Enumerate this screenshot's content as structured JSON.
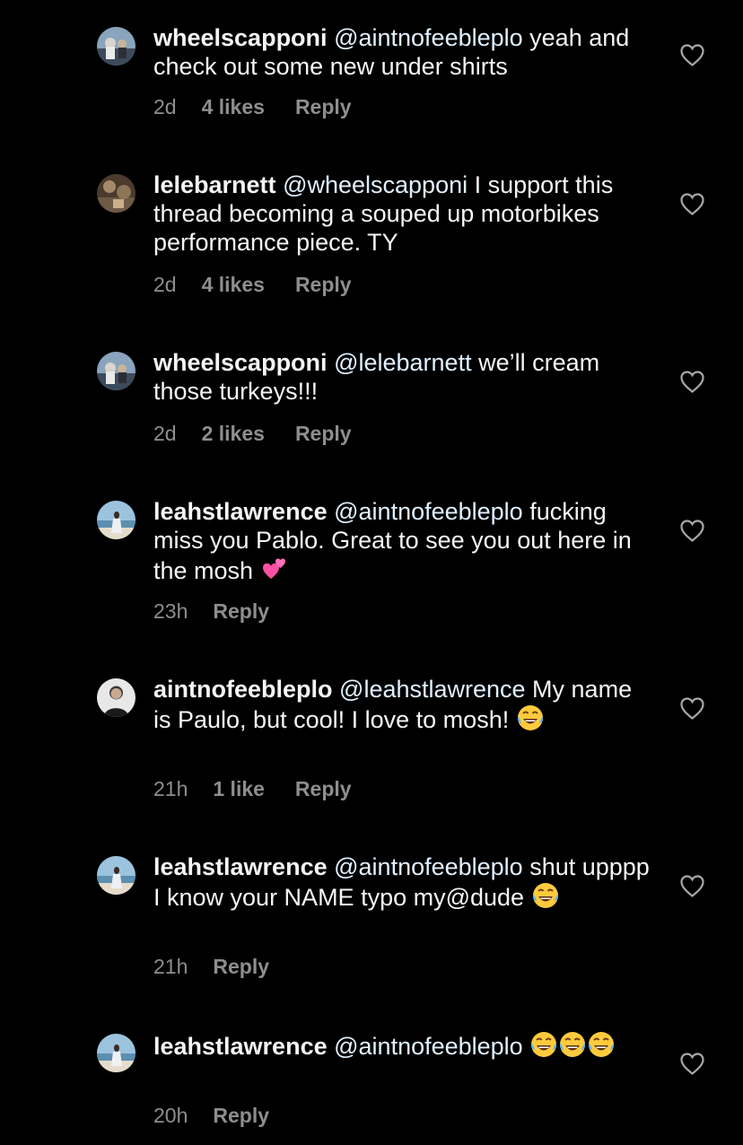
{
  "colors": {
    "background": "#000000",
    "text": "#f5f5f5",
    "mention": "#e0f1ff",
    "meta": "#8e8e8e"
  },
  "comments": [
    {
      "username": "wheelscapponi",
      "avatar": "wheelscapponi-avatar",
      "mention": "@aintnofeebleplo",
      "text": " yeah and check out some new under shirts",
      "emojis": [],
      "time": "2d",
      "likes": "4 likes",
      "reply": "Reply"
    },
    {
      "username": "lelebarnett",
      "avatar": "lelebarnett-avatar",
      "mention": "@wheelscapponi",
      "text": " I support this thread becoming a souped up motorbikes performance piece. TY",
      "emojis": [],
      "time": "2d",
      "likes": "4 likes",
      "reply": "Reply"
    },
    {
      "username": "wheelscapponi",
      "avatar": "wheelscapponi-avatar",
      "mention": "@lelebarnett",
      "text": " we’ll cream those turkeys!!!",
      "emojis": [],
      "time": "2d",
      "likes": "2 likes",
      "reply": "Reply"
    },
    {
      "username": "leahstlawrence",
      "avatar": "leahstlawrence-avatar",
      "mention": "@aintnofeebleplo",
      "text": " fucking miss you Pablo. Great to see you out here in the mosh ",
      "emojis": [
        "two-hearts-emoji"
      ],
      "time": "23h",
      "likes": "",
      "reply": "Reply"
    },
    {
      "username": "aintnofeebleplo",
      "avatar": "aintnofeebleplo-avatar",
      "mention": "@leahstlawrence",
      "text": " My name is Paulo, but cool! I love to mosh! ",
      "emojis": [
        "tears-of-joy-emoji"
      ],
      "time": "21h",
      "likes": "1 like",
      "reply": "Reply"
    },
    {
      "username": "leahstlawrence",
      "avatar": "leahstlawrence-avatar",
      "mention": "@aintnofeebleplo",
      "text": " shut upppp I know your NAME typo my@dude ",
      "emojis": [
        "tears-of-joy-emoji"
      ],
      "time": "21h",
      "likes": "",
      "reply": "Reply"
    },
    {
      "username": "leahstlawrence",
      "avatar": "leahstlawrence-avatar",
      "mention": "@aintnofeebleplo",
      "text": " ",
      "emojis": [
        "tears-of-joy-emoji",
        "tears-of-joy-emoji",
        "tears-of-joy-emoji"
      ],
      "time": "20h",
      "likes": "",
      "reply": "Reply"
    }
  ]
}
